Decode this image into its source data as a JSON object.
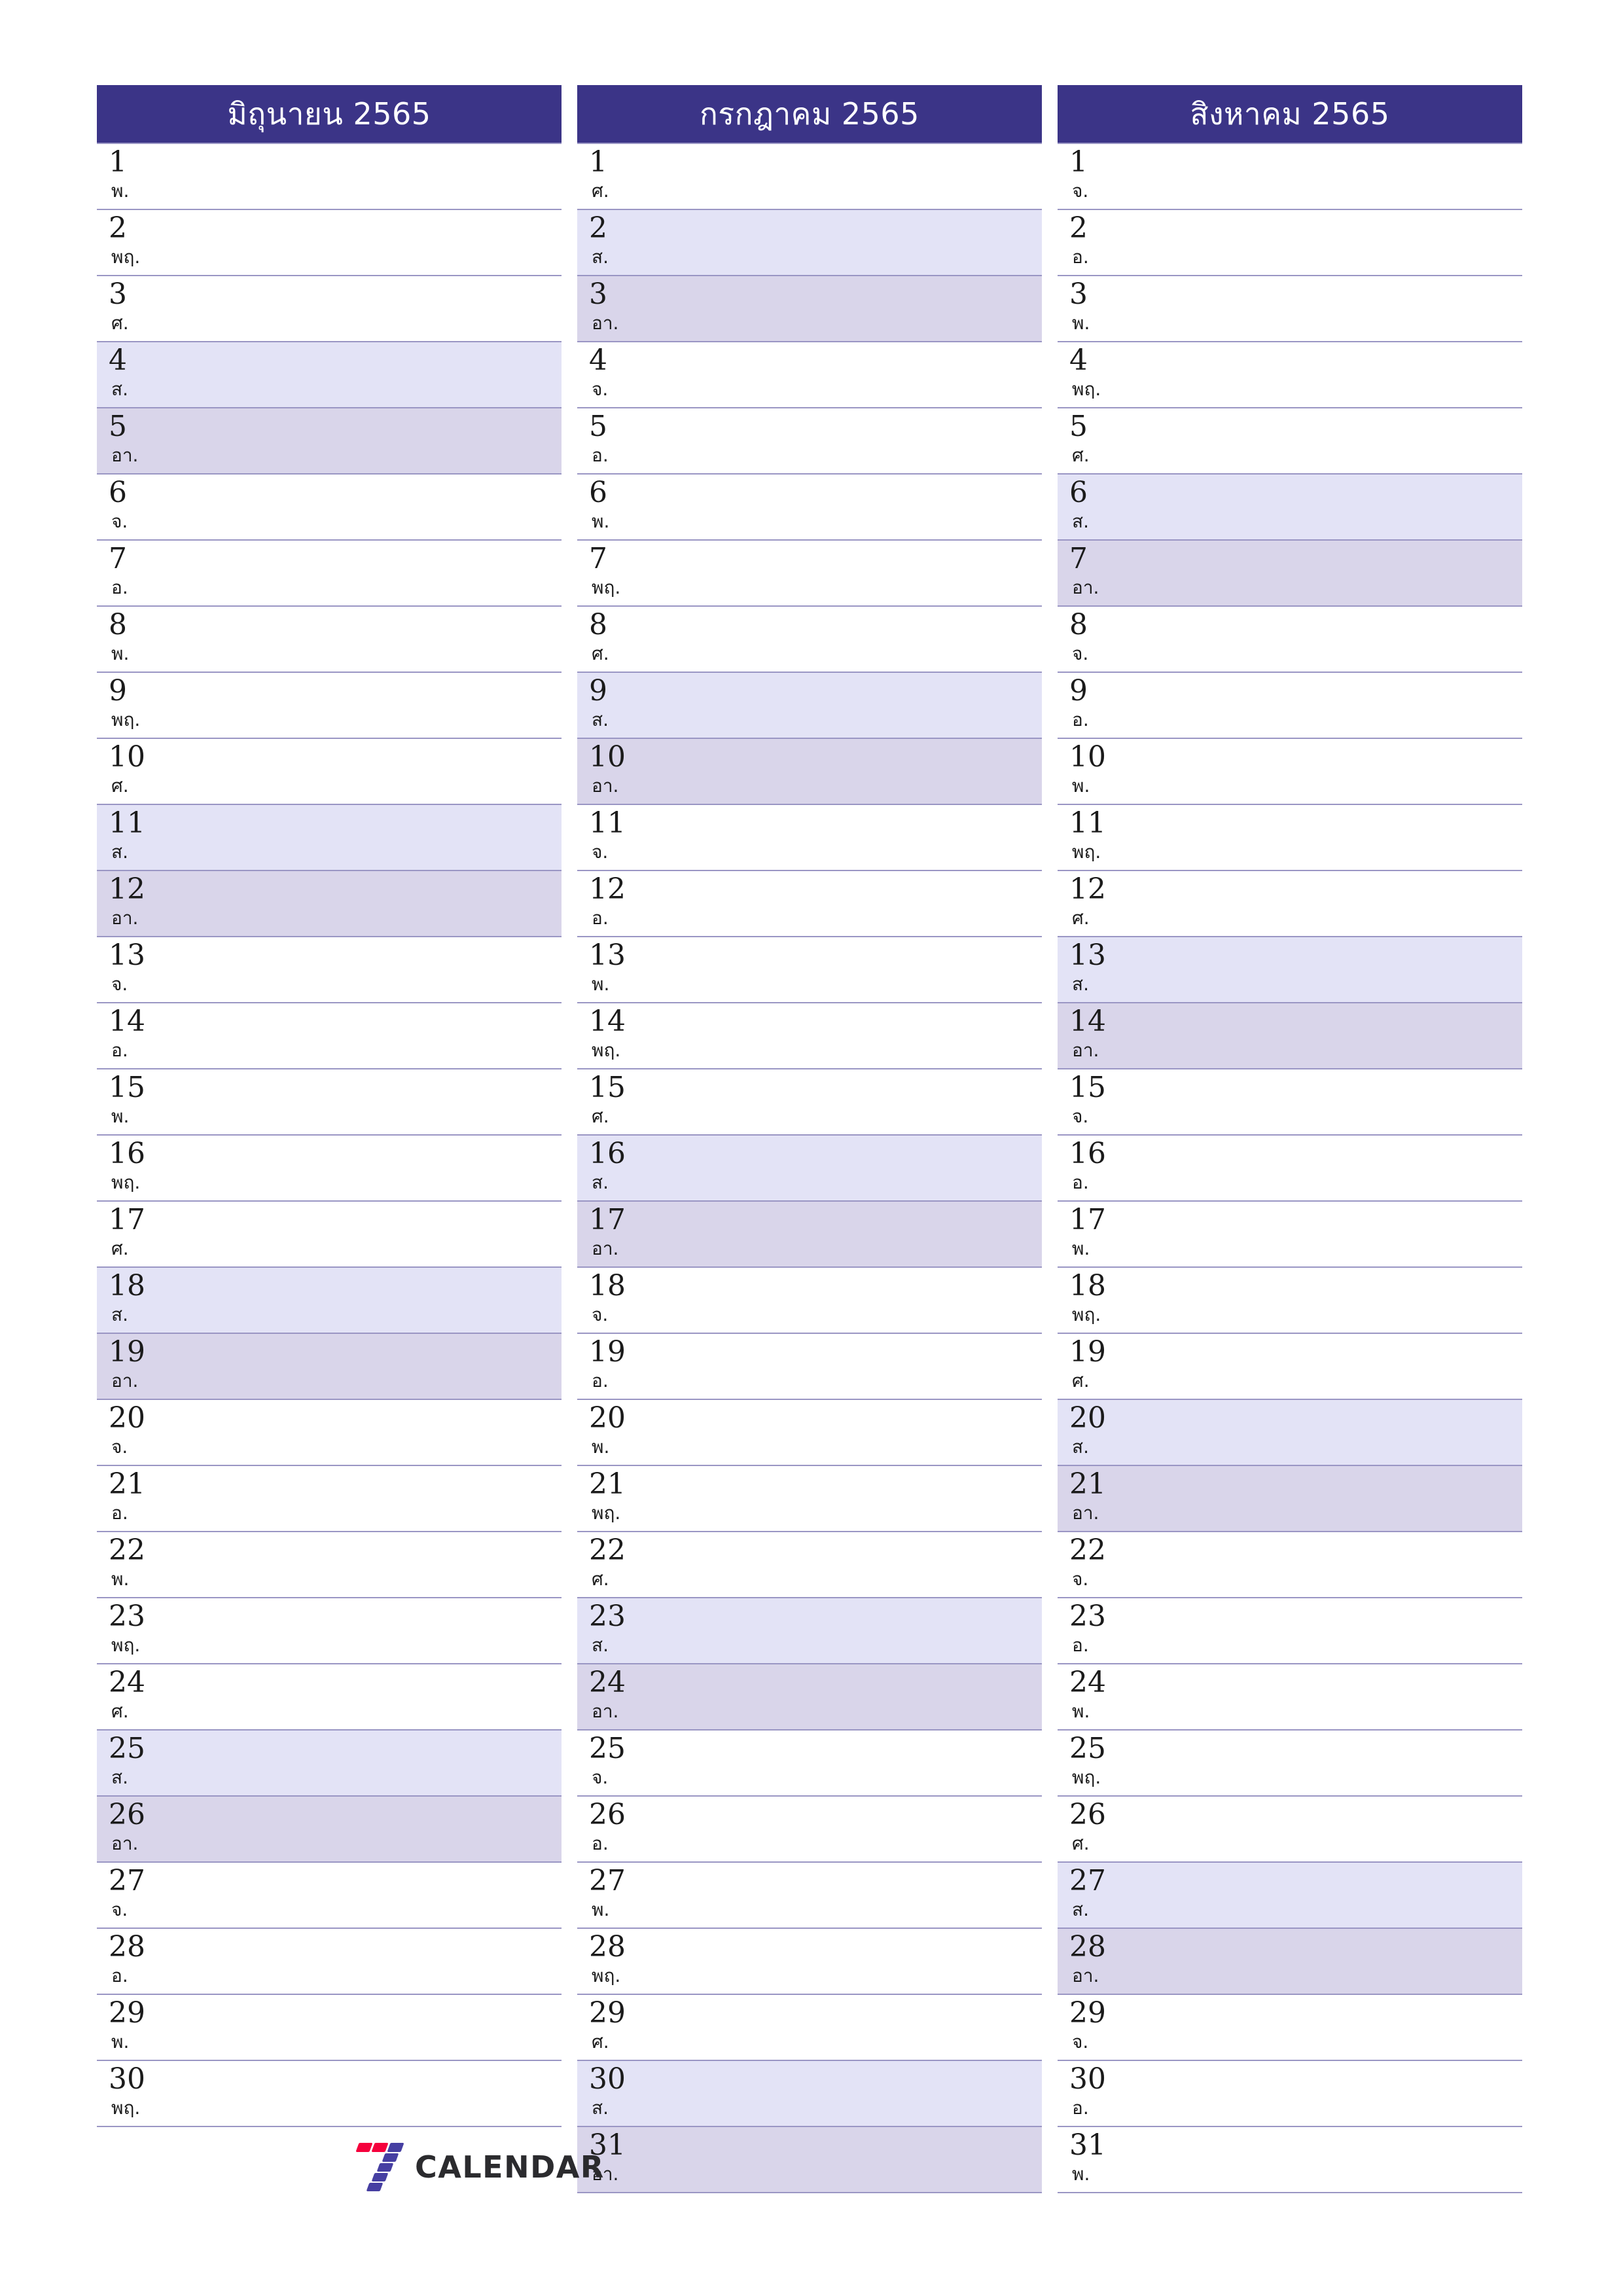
{
  "document": {
    "type": "three-month-planner",
    "page_size": "A4-portrait",
    "orientation": "portrait",
    "locale": "th",
    "year_label": "2565"
  },
  "colors": {
    "header_background": "#3b3487",
    "header_text": "#ffffff",
    "saturday_background": "#e3e3f6",
    "sunday_background": "#d9d5ea",
    "weekday_background": "#ffffff",
    "rule_line": "#9a96c4",
    "day_text": "#1b1b1b",
    "logo_red": "#f5003c",
    "logo_purple": "#463fa2",
    "logo_word": "#2b2b2e"
  },
  "weekday_abbr": {
    "mon": "จ.",
    "tue": "อ.",
    "wed": "พ.",
    "thu": "พฤ.",
    "fri": "ศ.",
    "sat": "ส.",
    "sun": "อา."
  },
  "months": [
    {
      "title": "มิถุนายน 2565",
      "name": "มิถุนายน",
      "year": "2565",
      "days": [
        {
          "num": "1",
          "abbr": "พ.",
          "kind": "weekday"
        },
        {
          "num": "2",
          "abbr": "พฤ.",
          "kind": "weekday"
        },
        {
          "num": "3",
          "abbr": "ศ.",
          "kind": "weekday"
        },
        {
          "num": "4",
          "abbr": "ส.",
          "kind": "sat"
        },
        {
          "num": "5",
          "abbr": "อา.",
          "kind": "sun"
        },
        {
          "num": "6",
          "abbr": "จ.",
          "kind": "weekday"
        },
        {
          "num": "7",
          "abbr": "อ.",
          "kind": "weekday"
        },
        {
          "num": "8",
          "abbr": "พ.",
          "kind": "weekday"
        },
        {
          "num": "9",
          "abbr": "พฤ.",
          "kind": "weekday"
        },
        {
          "num": "10",
          "abbr": "ศ.",
          "kind": "weekday"
        },
        {
          "num": "11",
          "abbr": "ส.",
          "kind": "sat"
        },
        {
          "num": "12",
          "abbr": "อา.",
          "kind": "sun"
        },
        {
          "num": "13",
          "abbr": "จ.",
          "kind": "weekday"
        },
        {
          "num": "14",
          "abbr": "อ.",
          "kind": "weekday"
        },
        {
          "num": "15",
          "abbr": "พ.",
          "kind": "weekday"
        },
        {
          "num": "16",
          "abbr": "พฤ.",
          "kind": "weekday"
        },
        {
          "num": "17",
          "abbr": "ศ.",
          "kind": "weekday"
        },
        {
          "num": "18",
          "abbr": "ส.",
          "kind": "sat"
        },
        {
          "num": "19",
          "abbr": "อา.",
          "kind": "sun"
        },
        {
          "num": "20",
          "abbr": "จ.",
          "kind": "weekday"
        },
        {
          "num": "21",
          "abbr": "อ.",
          "kind": "weekday"
        },
        {
          "num": "22",
          "abbr": "พ.",
          "kind": "weekday"
        },
        {
          "num": "23",
          "abbr": "พฤ.",
          "kind": "weekday"
        },
        {
          "num": "24",
          "abbr": "ศ.",
          "kind": "weekday"
        },
        {
          "num": "25",
          "abbr": "ส.",
          "kind": "sat"
        },
        {
          "num": "26",
          "abbr": "อา.",
          "kind": "sun"
        },
        {
          "num": "27",
          "abbr": "จ.",
          "kind": "weekday"
        },
        {
          "num": "28",
          "abbr": "อ.",
          "kind": "weekday"
        },
        {
          "num": "29",
          "abbr": "พ.",
          "kind": "weekday"
        },
        {
          "num": "30",
          "abbr": "พฤ.",
          "kind": "weekday"
        }
      ]
    },
    {
      "title": "กรกฎาคม 2565",
      "name": "กรกฎาคม",
      "year": "2565",
      "days": [
        {
          "num": "1",
          "abbr": "ศ.",
          "kind": "weekday"
        },
        {
          "num": "2",
          "abbr": "ส.",
          "kind": "sat"
        },
        {
          "num": "3",
          "abbr": "อา.",
          "kind": "sun"
        },
        {
          "num": "4",
          "abbr": "จ.",
          "kind": "weekday"
        },
        {
          "num": "5",
          "abbr": "อ.",
          "kind": "weekday"
        },
        {
          "num": "6",
          "abbr": "พ.",
          "kind": "weekday"
        },
        {
          "num": "7",
          "abbr": "พฤ.",
          "kind": "weekday"
        },
        {
          "num": "8",
          "abbr": "ศ.",
          "kind": "weekday"
        },
        {
          "num": "9",
          "abbr": "ส.",
          "kind": "sat"
        },
        {
          "num": "10",
          "abbr": "อา.",
          "kind": "sun"
        },
        {
          "num": "11",
          "abbr": "จ.",
          "kind": "weekday"
        },
        {
          "num": "12",
          "abbr": "อ.",
          "kind": "weekday"
        },
        {
          "num": "13",
          "abbr": "พ.",
          "kind": "weekday"
        },
        {
          "num": "14",
          "abbr": "พฤ.",
          "kind": "weekday"
        },
        {
          "num": "15",
          "abbr": "ศ.",
          "kind": "weekday"
        },
        {
          "num": "16",
          "abbr": "ส.",
          "kind": "sat"
        },
        {
          "num": "17",
          "abbr": "อา.",
          "kind": "sun"
        },
        {
          "num": "18",
          "abbr": "จ.",
          "kind": "weekday"
        },
        {
          "num": "19",
          "abbr": "อ.",
          "kind": "weekday"
        },
        {
          "num": "20",
          "abbr": "พ.",
          "kind": "weekday"
        },
        {
          "num": "21",
          "abbr": "พฤ.",
          "kind": "weekday"
        },
        {
          "num": "22",
          "abbr": "ศ.",
          "kind": "weekday"
        },
        {
          "num": "23",
          "abbr": "ส.",
          "kind": "sat"
        },
        {
          "num": "24",
          "abbr": "อา.",
          "kind": "sun"
        },
        {
          "num": "25",
          "abbr": "จ.",
          "kind": "weekday"
        },
        {
          "num": "26",
          "abbr": "อ.",
          "kind": "weekday"
        },
        {
          "num": "27",
          "abbr": "พ.",
          "kind": "weekday"
        },
        {
          "num": "28",
          "abbr": "พฤ.",
          "kind": "weekday"
        },
        {
          "num": "29",
          "abbr": "ศ.",
          "kind": "weekday"
        },
        {
          "num": "30",
          "abbr": "ส.",
          "kind": "sat"
        },
        {
          "num": "31",
          "abbr": "อา.",
          "kind": "sun"
        }
      ]
    },
    {
      "title": "สิงหาคม 2565",
      "name": "สิงหาคม",
      "year": "2565",
      "days": [
        {
          "num": "1",
          "abbr": "จ.",
          "kind": "weekday"
        },
        {
          "num": "2",
          "abbr": "อ.",
          "kind": "weekday"
        },
        {
          "num": "3",
          "abbr": "พ.",
          "kind": "weekday"
        },
        {
          "num": "4",
          "abbr": "พฤ.",
          "kind": "weekday"
        },
        {
          "num": "5",
          "abbr": "ศ.",
          "kind": "weekday"
        },
        {
          "num": "6",
          "abbr": "ส.",
          "kind": "sat"
        },
        {
          "num": "7",
          "abbr": "อา.",
          "kind": "sun"
        },
        {
          "num": "8",
          "abbr": "จ.",
          "kind": "weekday"
        },
        {
          "num": "9",
          "abbr": "อ.",
          "kind": "weekday"
        },
        {
          "num": "10",
          "abbr": "พ.",
          "kind": "weekday"
        },
        {
          "num": "11",
          "abbr": "พฤ.",
          "kind": "weekday"
        },
        {
          "num": "12",
          "abbr": "ศ.",
          "kind": "weekday"
        },
        {
          "num": "13",
          "abbr": "ส.",
          "kind": "sat"
        },
        {
          "num": "14",
          "abbr": "อา.",
          "kind": "sun"
        },
        {
          "num": "15",
          "abbr": "จ.",
          "kind": "weekday"
        },
        {
          "num": "16",
          "abbr": "อ.",
          "kind": "weekday"
        },
        {
          "num": "17",
          "abbr": "พ.",
          "kind": "weekday"
        },
        {
          "num": "18",
          "abbr": "พฤ.",
          "kind": "weekday"
        },
        {
          "num": "19",
          "abbr": "ศ.",
          "kind": "weekday"
        },
        {
          "num": "20",
          "abbr": "ส.",
          "kind": "sat"
        },
        {
          "num": "21",
          "abbr": "อา.",
          "kind": "sun"
        },
        {
          "num": "22",
          "abbr": "จ.",
          "kind": "weekday"
        },
        {
          "num": "23",
          "abbr": "อ.",
          "kind": "weekday"
        },
        {
          "num": "24",
          "abbr": "พ.",
          "kind": "weekday"
        },
        {
          "num": "25",
          "abbr": "พฤ.",
          "kind": "weekday"
        },
        {
          "num": "26",
          "abbr": "ศ.",
          "kind": "weekday"
        },
        {
          "num": "27",
          "abbr": "ส.",
          "kind": "sat"
        },
        {
          "num": "28",
          "abbr": "อา.",
          "kind": "sun"
        },
        {
          "num": "29",
          "abbr": "จ.",
          "kind": "weekday"
        },
        {
          "num": "30",
          "abbr": "อ.",
          "kind": "weekday"
        },
        {
          "num": "31",
          "abbr": "พ.",
          "kind": "weekday"
        }
      ]
    }
  ],
  "logo": {
    "word": "CALENDAR",
    "mark": "seven-logo-icon"
  }
}
